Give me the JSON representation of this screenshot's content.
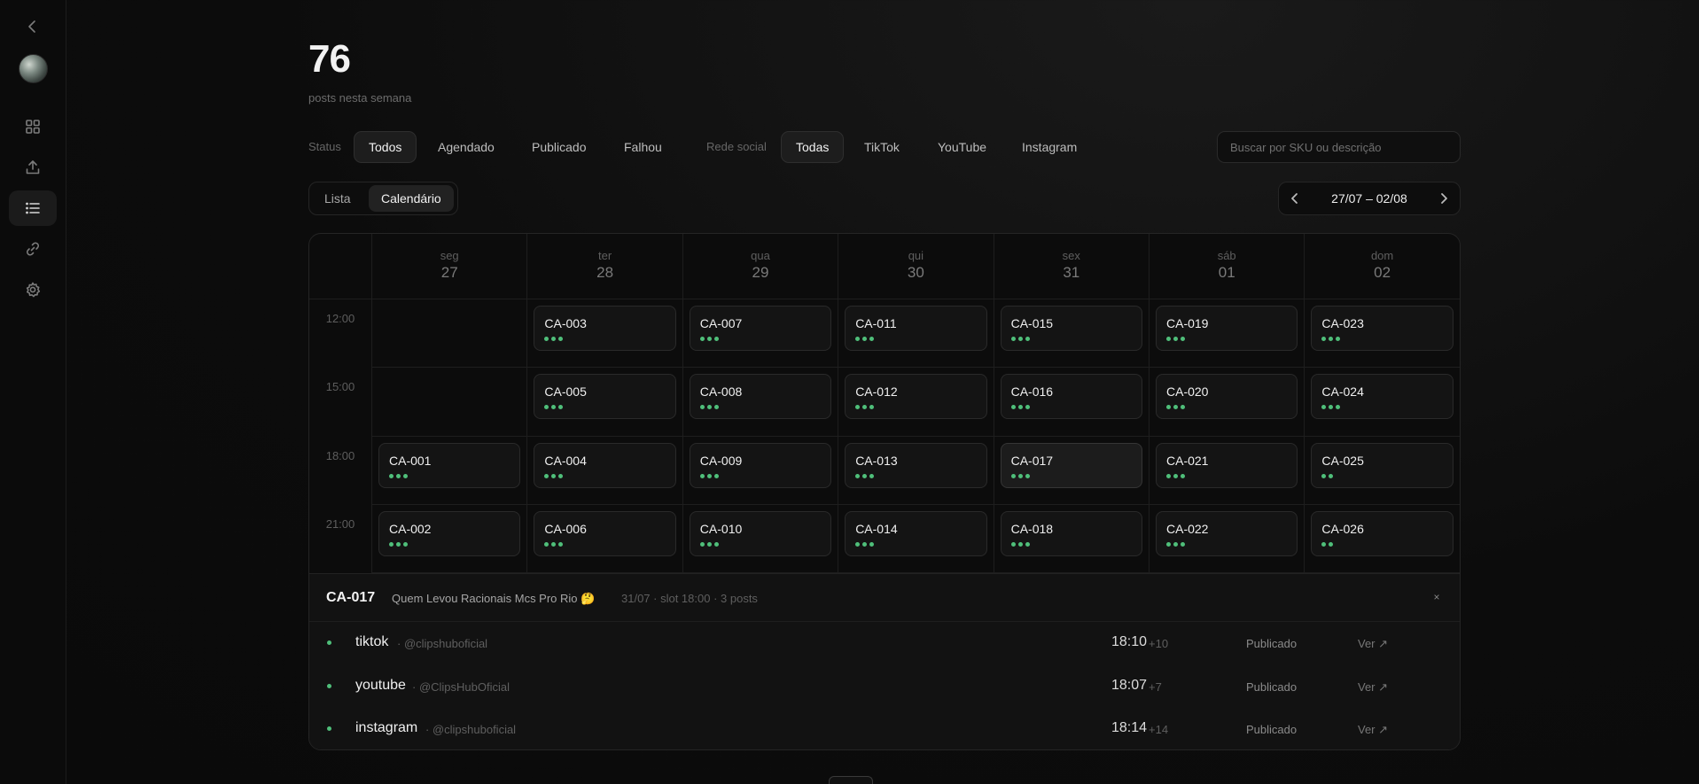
{
  "summary": {
    "count": "76",
    "caption": "posts nesta semana"
  },
  "sidebar": {
    "items": [
      {
        "icon": "back-icon"
      },
      {
        "icon": "grid-icon"
      },
      {
        "icon": "upload-icon"
      },
      {
        "icon": "list-icon",
        "active": true
      },
      {
        "icon": "link-icon"
      },
      {
        "icon": "settings-icon"
      }
    ]
  },
  "filters": {
    "status_label": "Status",
    "status_options": [
      "Todos",
      "Agendado",
      "Publicado",
      "Falhou"
    ],
    "status_selected": "Todos",
    "network_label": "Rede social",
    "network_options": [
      "Todas",
      "TikTok",
      "YouTube",
      "Instagram"
    ],
    "network_selected": "Todas",
    "search_placeholder": "Buscar por SKU ou descrição"
  },
  "view": {
    "list_label": "Lista",
    "calendar_label": "Calendário",
    "selected": "Calendário"
  },
  "week": {
    "range": "27/07 – 02/08"
  },
  "calendar": {
    "days": [
      {
        "name": "seg",
        "date": "27"
      },
      {
        "name": "ter",
        "date": "28"
      },
      {
        "name": "qua",
        "date": "29"
      },
      {
        "name": "qui",
        "date": "30"
      },
      {
        "name": "sex",
        "date": "31"
      },
      {
        "name": "sáb",
        "date": "01"
      },
      {
        "name": "dom",
        "date": "02"
      }
    ],
    "slots": [
      "12:00",
      "15:00",
      "18:00",
      "21:00"
    ],
    "cells": [
      [
        null,
        {
          "sku": "CA-003",
          "dots": 3
        },
        {
          "sku": "CA-007",
          "dots": 3
        },
        {
          "sku": "CA-011",
          "dots": 3
        },
        {
          "sku": "CA-015",
          "dots": 3
        },
        {
          "sku": "CA-019",
          "dots": 3
        },
        {
          "sku": "CA-023",
          "dots": 3
        }
      ],
      [
        null,
        {
          "sku": "CA-005",
          "dots": 3
        },
        {
          "sku": "CA-008",
          "dots": 3
        },
        {
          "sku": "CA-012",
          "dots": 3
        },
        {
          "sku": "CA-016",
          "dots": 3
        },
        {
          "sku": "CA-020",
          "dots": 3
        },
        {
          "sku": "CA-024",
          "dots": 3
        }
      ],
      [
        {
          "sku": "CA-001",
          "dots": 3
        },
        {
          "sku": "CA-004",
          "dots": 3
        },
        {
          "sku": "CA-009",
          "dots": 3
        },
        {
          "sku": "CA-013",
          "dots": 3
        },
        {
          "sku": "CA-017",
          "dots": 3,
          "selected": true
        },
        {
          "sku": "CA-021",
          "dots": 3
        },
        {
          "sku": "CA-025",
          "dots": 2
        }
      ],
      [
        {
          "sku": "CA-002",
          "dots": 3
        },
        {
          "sku": "CA-006",
          "dots": 3
        },
        {
          "sku": "CA-010",
          "dots": 3
        },
        {
          "sku": "CA-014",
          "dots": 3
        },
        {
          "sku": "CA-018",
          "dots": 3
        },
        {
          "sku": "CA-022",
          "dots": 3
        },
        {
          "sku": "CA-026",
          "dots": 2
        }
      ]
    ]
  },
  "detail": {
    "sku": "CA-017",
    "title": "Quem Levou Racionais Mcs Pro Rio 🤔",
    "meta": "31/07 · slot 18:00 · 3 posts",
    "close": "×",
    "posts": [
      {
        "network": "tiktok",
        "handle": "· @clipshuboficial",
        "time": "18:10",
        "delta": "+10",
        "status": "Publicado",
        "link": "Ver ↗"
      },
      {
        "network": "youtube",
        "handle": "· @ClipsHubOficial",
        "time": "18:07",
        "delta": "+7",
        "status": "Publicado",
        "link": "Ver ↗"
      },
      {
        "network": "instagram",
        "handle": "· @clipshuboficial",
        "time": "18:14",
        "delta": "+14",
        "status": "Publicado",
        "link": "Ver ↗"
      }
    ]
  },
  "colors": {
    "accent_green": "#4fbf7a",
    "background": "#0c0c0c"
  }
}
